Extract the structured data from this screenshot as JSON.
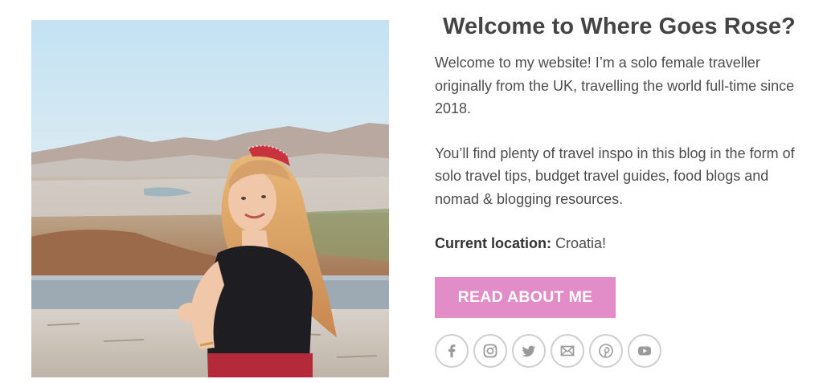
{
  "heading": "Welcome to Where Goes Rose?",
  "intro_paragraphs": [
    "Welcome to my website! I’m a solo female traveller originally from the UK, travelling the world full-time since 2018.",
    "You’ll find plenty of travel inspo in this blog in the form of solo travel tips, budget travel guides, food blogs and nomad & blogging resources."
  ],
  "location": {
    "label": "Current location:",
    "value": " Croatia!"
  },
  "cta_button": "READ ABOUT ME",
  "social_icons": [
    "facebook-icon",
    "instagram-icon",
    "twitter-icon",
    "email-icon",
    "pinterest-icon",
    "youtube-icon"
  ],
  "colors": {
    "button": "#e28dc7",
    "heading": "#444444",
    "icon_border": "#cfcfcf"
  }
}
